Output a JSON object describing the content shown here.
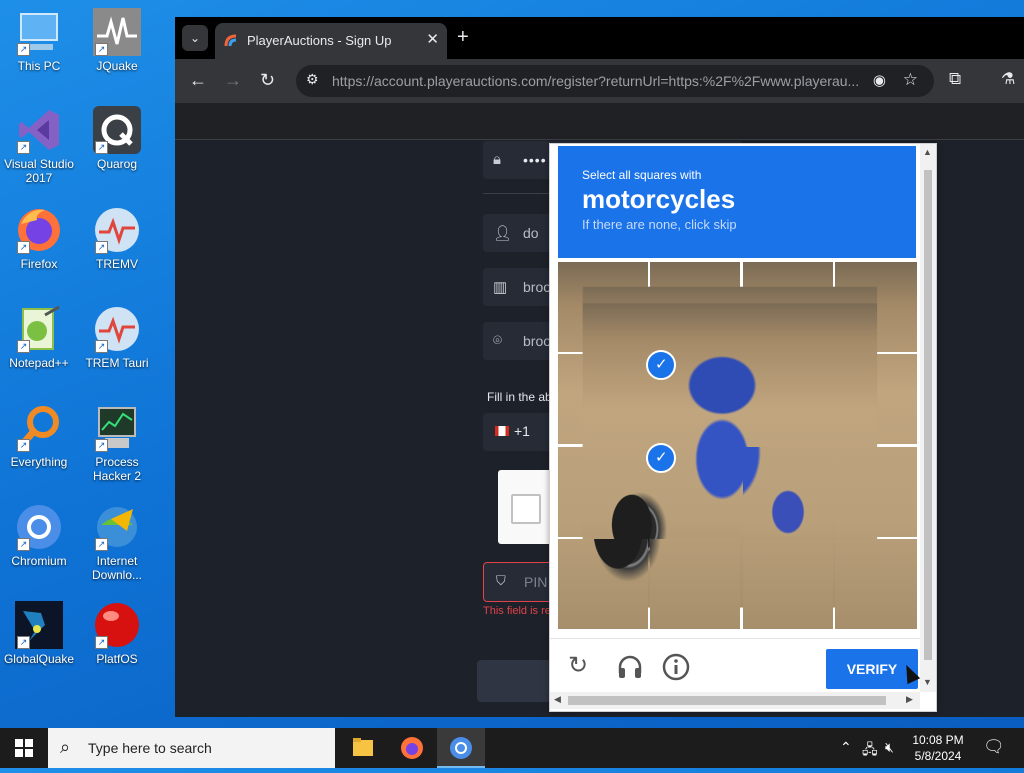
{
  "desktop": {
    "icons": [
      {
        "label": "This PC",
        "icon": "computer-icon"
      },
      {
        "label": "JQuake",
        "icon": "jquake-icon"
      },
      {
        "label": "Visual Studio 2017",
        "icon": "visual-studio-icon"
      },
      {
        "label": "Quarog",
        "icon": "quarog-icon"
      },
      {
        "label": "Firefox",
        "icon": "firefox-icon"
      },
      {
        "label": "TREMV",
        "icon": "tremv-icon"
      },
      {
        "label": "Notepad++",
        "icon": "notepadpp-icon"
      },
      {
        "label": "TREM Tauri",
        "icon": "trem-tauri-icon"
      },
      {
        "label": "Everything",
        "icon": "everything-icon"
      },
      {
        "label": "Process Hacker 2",
        "icon": "process-hacker-icon"
      },
      {
        "label": "Chromium",
        "icon": "chromium-icon"
      },
      {
        "label": "Internet Downlo...",
        "icon": "idm-icon"
      },
      {
        "label": "GlobalQuake",
        "icon": "globalquake-icon"
      },
      {
        "label": "PlatfOS",
        "icon": "platfos-icon"
      }
    ]
  },
  "browser": {
    "tab_title": "PlayerAuctions - Sign Up",
    "url": "https://account.playerauctions.com/register?returnUrl=https:%2F%2Fwww.playerau..."
  },
  "form": {
    "password_mask": "••••",
    "username_value": "do",
    "address_value": "broo",
    "city_value": "broo",
    "hint": "Fill in the ab",
    "phone_code": "+1",
    "pin_placeholder": "PIN",
    "error": "This field is re"
  },
  "captcha": {
    "line1": "Select all squares with",
    "target": "motorcycles",
    "line3": "If there are none, click skip",
    "selected_tiles": [
      5,
      9
    ],
    "verify_label": "VERIFY"
  },
  "taskbar": {
    "search_placeholder": "Type here to search",
    "time": "10:08 PM",
    "date": "5/8/2024"
  }
}
